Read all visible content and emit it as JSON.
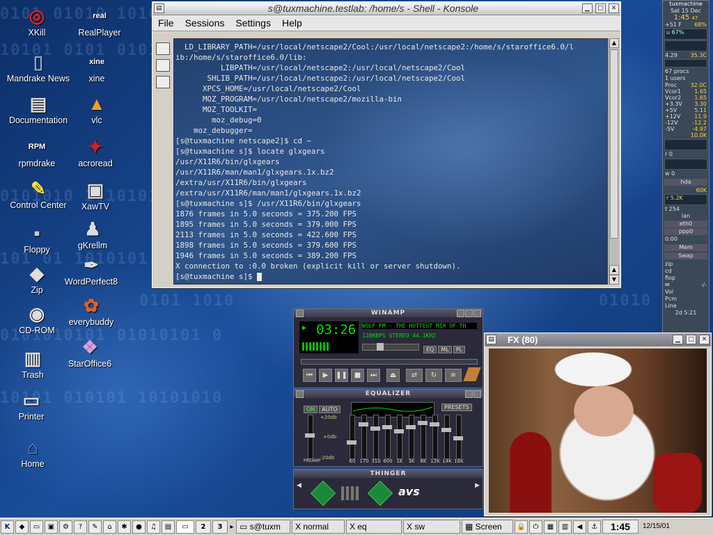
{
  "desktop": {
    "icons": [
      {
        "label": "XKill",
        "icon": "xkill-icon"
      },
      {
        "label": "RealPlayer",
        "icon": "realplayer-icon"
      },
      {
        "label": "Mandrake News",
        "icon": "book-icon"
      },
      {
        "label": "xine",
        "icon": "xine-icon"
      },
      {
        "label": "Documentation",
        "icon": "documentation-icon"
      },
      {
        "label": "vlc",
        "icon": "vlc-icon"
      },
      {
        "label": "rpmdrake",
        "icon": "rpm-icon"
      },
      {
        "label": "acroread",
        "icon": "acroread-icon"
      },
      {
        "label": "Control Center",
        "icon": "control-center-icon"
      },
      {
        "label": "XawTV",
        "icon": "tv-icon"
      },
      {
        "label": "Floppy",
        "icon": "floppy-icon"
      },
      {
        "label": "gKrellm",
        "icon": "gkrellm-icon"
      },
      {
        "label": "Zip",
        "icon": "zip-icon"
      },
      {
        "label": "WordPerfect8",
        "icon": "wordperfect-icon"
      },
      {
        "label": "CD-ROM",
        "icon": "cdrom-icon"
      },
      {
        "label": "everybuddy",
        "icon": "everybuddy-icon"
      },
      {
        "label": "Trash",
        "icon": "trash-icon"
      },
      {
        "label": "StarOffice6",
        "icon": "staroffice-icon"
      },
      {
        "label": "Printer",
        "icon": "printer-icon"
      },
      {
        "label": "Home",
        "icon": "home-icon"
      }
    ]
  },
  "konsole": {
    "title": "s@tuxmachine.testlab: /home/s - Shell - Konsole",
    "menu": [
      "File",
      "Sessions",
      "Settings",
      "Help"
    ],
    "lines": [
      "  LD_LIBRARY_PATH=/usr/local/netscape2/Cool:/usr/local/netscape2:/home/s/staroffice6.0/l",
      "ib:/home/s/staroffice6.0/lib:",
      "          LIBPATH=/usr/local/netscape2:/usr/local/netscape2/Cool",
      "       SHLIB_PATH=/usr/local/netscape2:/usr/local/netscape2/Cool",
      "      XPCS_HOME=/usr/local/netscape2/Cool",
      "      MOZ_PROGRAM=/usr/local/netscape2/mozilla-bin",
      "      MOZ_TOOLKIT=",
      "        moz_debug=0",
      "    moz_debugger=",
      "[s@tuxmachine netscape2]$ cd ~",
      "[s@tuxmachine s]$ locate glxgears",
      "/usr/X11R6/bin/glxgears",
      "/usr/X11R6/man/man1/glxgears.1x.bz2",
      "/extra/usr/X11R6/bin/glxgears",
      "/extra/usr/X11R6/man/man1/glxgears.1x.bz2",
      "[s@tuxmachine s]$ /usr/X11R6/bin/glxgears",
      "1876 frames in 5.0 seconds = 375.200 FPS",
      "1895 frames in 5.0 seconds = 379.000 FPS",
      "2113 frames in 5.0 seconds = 422.600 FPS",
      "1898 frames in 5.0 seconds = 379.600 FPS",
      "1946 frames in 5.0 seconds = 389.200 FPS",
      "X connection to :0.0 broken (explicit kill or server shutdown)."
    ],
    "prompt": "[s@tuxmachine s]$ "
  },
  "winamp": {
    "title": "WINAMP",
    "time": "03:26",
    "song": "WOLF FM - THE HOTTEST MIX OF TH",
    "info": "128KBPS STEREO 44.1KHZ",
    "buttons": [
      "EQ",
      "PL",
      "ML"
    ],
    "equalizer": {
      "title": "EQUALIZER",
      "on": "ON",
      "auto": "AUTO",
      "presets": "PRESETS",
      "db_top": "+20db",
      "db_mid": "+0db",
      "db_bottom": "-20db",
      "preamp": "PREAMP",
      "bands": [
        "60",
        "170",
        "310",
        "600",
        "1K",
        "3K",
        "6K",
        "12K",
        "14K",
        "16K"
      ]
    },
    "thinger": {
      "title": "THINGER",
      "avs": "avs"
    }
  },
  "fx_window": {
    "title": "FX (80)"
  },
  "gkrellm": {
    "host": "tuxmachine",
    "date": "Sat 15 Dec",
    "time": "1:45",
    "seconds": "47",
    "temp": "+51 F",
    "humidity": "68%",
    "cpu": "u 67%",
    "load": "4.29",
    "load2": "35.3C",
    "procs": "67 procs",
    "users": "1 users",
    "proc_temp": "32.0C",
    "sensors": [
      {
        "k": "Vcor1",
        "v": "1.65"
      },
      {
        "k": "Vcor2",
        "v": "1.65"
      },
      {
        "k": "+3.3V",
        "v": "3.30"
      },
      {
        "k": "+5V",
        "v": "5.11"
      },
      {
        "k": "+12V",
        "v": "11.9"
      },
      {
        "k": "-12V",
        "v": "-12.2"
      },
      {
        "k": "-5V",
        "v": "-4.97"
      }
    ],
    "disk_total": "10.0K",
    "net_r": "r 0",
    "net_w": "w 0",
    "hda": "hda",
    "hda_val": "60K",
    "eth_val": "r 5.2K",
    "tx": "t 254",
    "lan": "lan",
    "eth0": "eth0",
    "ppp0": "ppp0",
    "ppp_val": "0:00",
    "mem": "Mem",
    "swap": "Swap",
    "mounts": [
      "zip",
      "cd",
      "flop"
    ],
    "mail": "-/-",
    "vol": "Vol",
    "pcm": "Pcm",
    "line": "Line",
    "uptime": "2d 5:21"
  },
  "taskbar": {
    "desktops": [
      "2",
      "3"
    ],
    "tasks": [
      "s@tuxm",
      "normal",
      "eq",
      "sw",
      "Screen"
    ],
    "clock": "1:45",
    "date": "12/15/01"
  }
}
